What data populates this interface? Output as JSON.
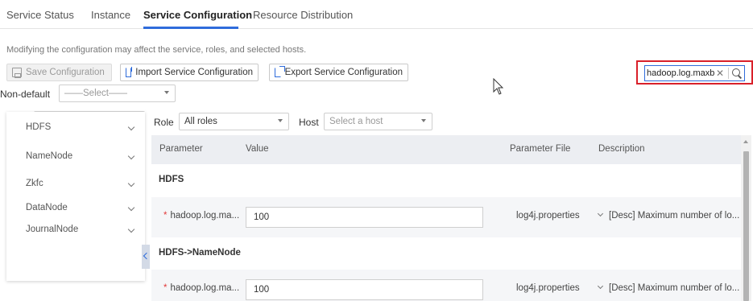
{
  "tabs": [
    {
      "label": "Service Status"
    },
    {
      "label": "Instance"
    },
    {
      "label": "Service Configuration"
    },
    {
      "label": "Resource Distribution"
    }
  ],
  "notice": "Modifying the configuration may affect the service, roles, and selected hosts.",
  "toolbar": {
    "save_label": "Save Configuration",
    "import_label": "Import Service Configuration",
    "export_label": "Export Service Configuration"
  },
  "search": {
    "value": "hadoop.log.maxbackupindex"
  },
  "filter": {
    "nondefault_label": "Non-default",
    "nondefault_value": "——Select——",
    "role_label": "Role",
    "role_value": "All roles",
    "host_label": "Host",
    "host_placeholder": "Select a host"
  },
  "tree": [
    {
      "label": "HDFS"
    },
    {
      "label": "NameNode"
    },
    {
      "label": "Zkfc"
    },
    {
      "label": "DataNode"
    },
    {
      "label": "JournalNode"
    }
  ],
  "table": {
    "headers": [
      "Parameter",
      "Value",
      "Parameter File",
      "Description"
    ],
    "groups": [
      {
        "name": "HDFS",
        "row": {
          "param": "hadoop.log.ma...",
          "value": "100",
          "file": "log4j.properties",
          "desc": "[Desc] Maximum number of lo..."
        }
      },
      {
        "name": "HDFS->NameNode",
        "row": {
          "param": "hadoop.log.ma...",
          "value": "100",
          "file": "log4j.properties",
          "desc": "[Desc] Maximum number of lo..."
        }
      }
    ]
  },
  "colors": {
    "accent": "#2f6cdb",
    "highlight": "#d9202a",
    "required": "#e23b3b"
  }
}
